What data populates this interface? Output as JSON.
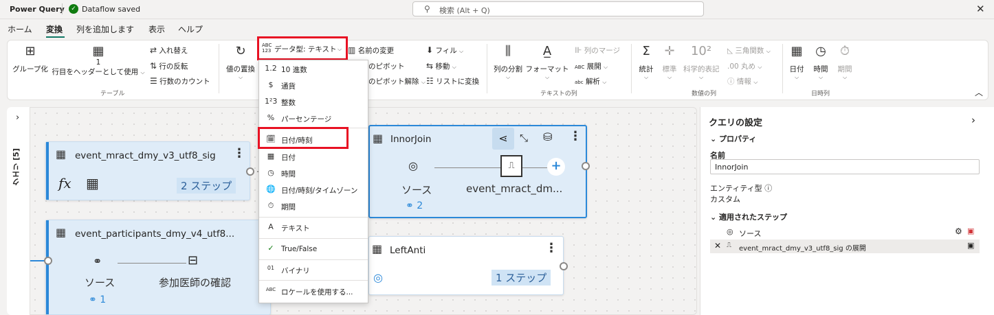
{
  "titlebar": {
    "app_title": "Power Query",
    "status": "Dataflow saved",
    "search_placeholder": "検索 (Alt + Q)"
  },
  "tabs": [
    "ホーム",
    "変換",
    "列を追加します",
    "表示",
    "ヘルプ"
  ],
  "active_tab": "変換",
  "ribbon": {
    "table_group": {
      "group_by": "グループ化",
      "use_first_row_count": "1",
      "use_first_row": "行目をヘッダーとして使用",
      "transpose": "入れ替え",
      "reverse_rows": "行の反転",
      "count_rows": "行数のカウント",
      "label": "テーブル"
    },
    "any_column": {
      "replace_values": "値の置換",
      "data_type": "データ型: テキスト",
      "rename": "名前の変更",
      "pivot": "のピボット",
      "unpivot": "のピボット解除",
      "fill": "フィル",
      "move": "移動",
      "convert_to_list": "リストに変換"
    },
    "text_column": {
      "split_column": "列の分割",
      "format": "フォーマット",
      "merge_columns": "列のマージ",
      "expand": "展開",
      "parse": "解析",
      "label": "テキストの列"
    },
    "number_column": {
      "statistics": "統計",
      "standard": "標準",
      "scientific": "科学的表記",
      "trigonometry": "三角関数",
      "rounding": "丸め",
      "information": "情報",
      "label": "数値の列"
    },
    "datetime_column": {
      "date": "日付",
      "time": "時間",
      "duration": "期間",
      "label": "日時列"
    }
  },
  "datatype_menu": {
    "items": [
      {
        "icon": "1.2",
        "label": "10 進数"
      },
      {
        "icon": "$",
        "label": "通貨"
      },
      {
        "icon": "1²3",
        "label": "整数"
      },
      {
        "icon": "%",
        "label": "パーセンテージ"
      },
      {
        "icon": "🗓",
        "label": "日付/時刻"
      },
      {
        "icon": "▦",
        "label": "日付"
      },
      {
        "icon": "◷",
        "label": "時間"
      },
      {
        "icon": "🌐",
        "label": "日付/時刻/タイムゾーン"
      },
      {
        "icon": "⏱",
        "label": "期間"
      },
      {
        "icon": "A",
        "label": "テキスト"
      },
      {
        "icon": "✓",
        "label": "True/False"
      },
      {
        "icon": "01",
        "label": "バイナリ"
      },
      {
        "icon": "ABC",
        "label": "ロケールを使用する..."
      }
    ]
  },
  "canvas": {
    "rail_label": "クエリ [5]",
    "cards": {
      "mract": {
        "title": "event_mract_dmy_v3_utf8_sig",
        "steps": "2 ステップ"
      },
      "participants": {
        "title": "event_participants_dmy_v4_utf8...",
        "source_label": "ソース",
        "step_label": "参加医師の確認",
        "link_count": "1"
      },
      "innor": {
        "title": "InnorJoin",
        "source_label": "ソース",
        "ref_label": "event_mract_dm...",
        "link_count": "2"
      },
      "leftanti": {
        "title": "LeftAnti",
        "steps": "1 ステップ"
      }
    }
  },
  "panel": {
    "title": "クエリの設定",
    "properties": "プロパティ",
    "name_label": "名前",
    "name_value": "InnorJoin",
    "entity_label": "エンティティ型",
    "entity_value": "カスタム",
    "applied_steps": "適用されたステップ",
    "steps": [
      "ソース",
      "event_mract_dmy_v3_utf8_sig の展開"
    ]
  },
  "colors": {
    "accent": "#117865",
    "selection": "#2b88d8",
    "highlight_box": "#e81123"
  }
}
